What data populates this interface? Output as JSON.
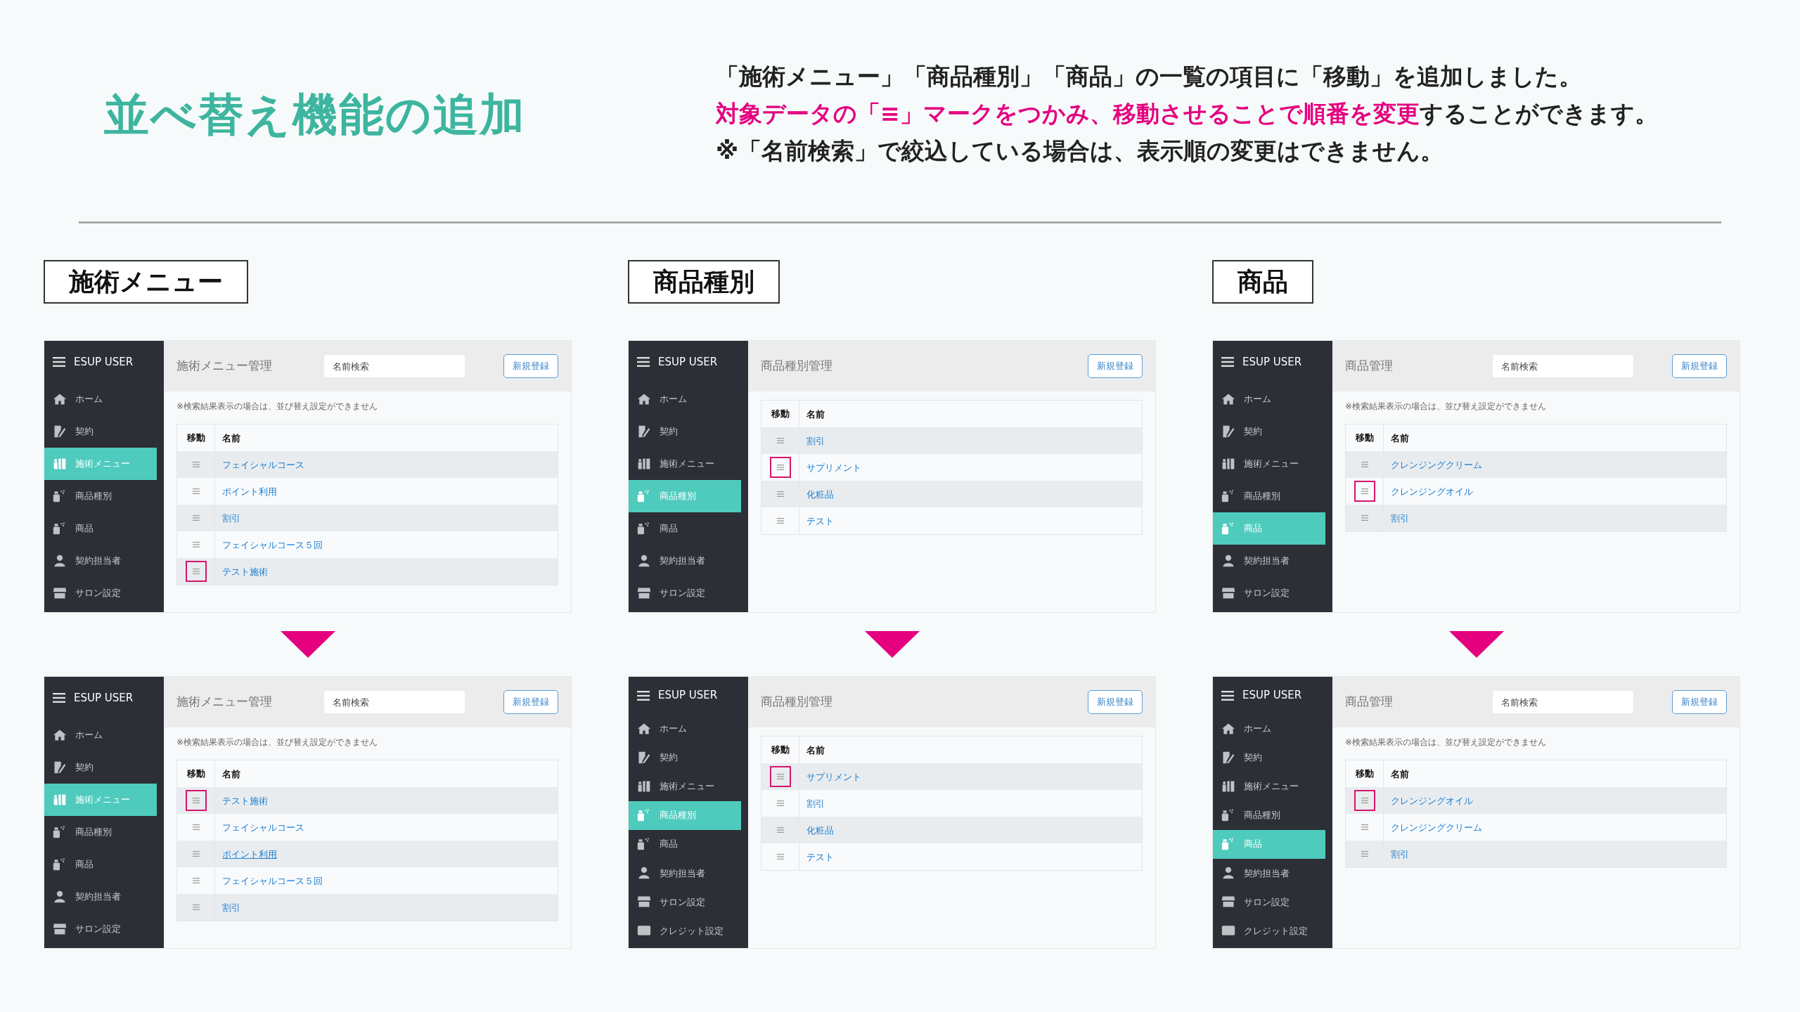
{
  "heading": "並べ替え機能の追加",
  "description": {
    "line_1": "「施術メニュー」「商品種別」「商品」の一覧の項目に「移動」を追加しました。",
    "line_2_highlight": "対象データの「≡」マークをつかみ、移動させることで順番を変更",
    "line_2_rest": "することができます。",
    "line_3": "※「名前検索」で絞込している場合は、表示順の変更はできません。"
  },
  "sections": [
    {
      "label": "施術メニュー",
      "before": {
        "brand": "ESUP USER",
        "sidebar": [
          {
            "label": "ホーム",
            "kind": "home",
            "selected": false
          },
          {
            "label": "契約",
            "kind": "contract",
            "selected": false
          },
          {
            "label": "施術メニュー",
            "kind": "treatment",
            "selected": true
          },
          {
            "label": "商品種別",
            "kind": "bottle",
            "selected": false
          },
          {
            "label": "商品",
            "kind": "bottle",
            "selected": false
          },
          {
            "label": "契約担当者",
            "kind": "person",
            "selected": false
          },
          {
            "label": "サロン設定",
            "kind": "store",
            "selected": false
          }
        ],
        "page_title": "施術メニュー管理",
        "search": {
          "placeholder": "名前検索"
        },
        "new_button": "新規登録",
        "note": "※検索結果表示の場合は、並び替え設定ができません",
        "columns": [
          "移動",
          "名前"
        ],
        "rows": [
          {
            "name": "フェイシャルコース",
            "marked": false,
            "hover": false
          },
          {
            "name": "ポイント利用",
            "marked": false,
            "hover": false
          },
          {
            "name": "割引",
            "marked": false,
            "hover": false
          },
          {
            "name": "フェイシャルコース５回",
            "marked": false,
            "hover": false
          },
          {
            "name": "テスト施術",
            "marked": true,
            "hover": false
          }
        ]
      },
      "after": {
        "brand": "ESUP USER",
        "sidebar": [
          {
            "label": "ホーム",
            "kind": "home",
            "selected": false
          },
          {
            "label": "契約",
            "kind": "contract",
            "selected": false
          },
          {
            "label": "施術メニュー",
            "kind": "treatment",
            "selected": true
          },
          {
            "label": "商品種別",
            "kind": "bottle",
            "selected": false
          },
          {
            "label": "商品",
            "kind": "bottle",
            "selected": false
          },
          {
            "label": "契約担当者",
            "kind": "person",
            "selected": false
          },
          {
            "label": "サロン設定",
            "kind": "store",
            "selected": false
          }
        ],
        "page_title": "施術メニュー管理",
        "search": {
          "placeholder": "名前検索"
        },
        "new_button": "新規登録",
        "note": "※検索結果表示の場合は、並び替え設定ができません",
        "columns": [
          "移動",
          "名前"
        ],
        "rows": [
          {
            "name": "テスト施術",
            "marked": true,
            "hover": false
          },
          {
            "name": "フェイシャルコース",
            "marked": false,
            "hover": false
          },
          {
            "name": "ポイント利用",
            "marked": false,
            "hover": true
          },
          {
            "name": "フェイシャルコース５回",
            "marked": false,
            "hover": false
          },
          {
            "name": "割引",
            "marked": false,
            "hover": false
          }
        ]
      }
    },
    {
      "label": "商品種別",
      "before": {
        "brand": "ESUP USER",
        "sidebar": [
          {
            "label": "ホーム",
            "kind": "home",
            "selected": false
          },
          {
            "label": "契約",
            "kind": "contract",
            "selected": false
          },
          {
            "label": "施術メニュー",
            "kind": "treatment",
            "selected": false
          },
          {
            "label": "商品種別",
            "kind": "bottle",
            "selected": true
          },
          {
            "label": "商品",
            "kind": "bottle",
            "selected": false
          },
          {
            "label": "契約担当者",
            "kind": "person",
            "selected": false
          },
          {
            "label": "サロン設定",
            "kind": "store",
            "selected": false
          }
        ],
        "page_title": "商品種別管理",
        "new_button": "新規登録",
        "columns": [
          "移動",
          "名前"
        ],
        "rows": [
          {
            "name": "割引",
            "marked": false,
            "hover": false
          },
          {
            "name": "サプリメント",
            "marked": true,
            "hover": false
          },
          {
            "name": "化粧品",
            "marked": false,
            "hover": false
          },
          {
            "name": "テスト",
            "marked": false,
            "hover": false
          }
        ]
      },
      "after": {
        "brand": "ESUP USER",
        "sidebar": [
          {
            "label": "ホーム",
            "kind": "home",
            "selected": false
          },
          {
            "label": "契約",
            "kind": "contract",
            "selected": false
          },
          {
            "label": "施術メニュー",
            "kind": "treatment",
            "selected": false
          },
          {
            "label": "商品種別",
            "kind": "bottle",
            "selected": true
          },
          {
            "label": "商品",
            "kind": "bottle",
            "selected": false
          },
          {
            "label": "契約担当者",
            "kind": "person",
            "selected": false
          },
          {
            "label": "サロン設定",
            "kind": "store",
            "selected": false
          },
          {
            "label": "クレジット設定",
            "kind": "card",
            "selected": false
          }
        ],
        "page_title": "商品種別管理",
        "new_button": "新規登録",
        "columns": [
          "移動",
          "名前"
        ],
        "rows": [
          {
            "name": "サプリメント",
            "marked": true,
            "hover": false
          },
          {
            "name": "割引",
            "marked": false,
            "hover": false
          },
          {
            "name": "化粧品",
            "marked": false,
            "hover": false
          },
          {
            "name": "テスト",
            "marked": false,
            "hover": false
          }
        ]
      }
    },
    {
      "label": "商品",
      "before": {
        "brand": "ESUP USER",
        "sidebar": [
          {
            "label": "ホーム",
            "kind": "home",
            "selected": false
          },
          {
            "label": "契約",
            "kind": "contract",
            "selected": false
          },
          {
            "label": "施術メニュー",
            "kind": "treatment",
            "selected": false
          },
          {
            "label": "商品種別",
            "kind": "bottle",
            "selected": false
          },
          {
            "label": "商品",
            "kind": "bottle",
            "selected": true
          },
          {
            "label": "契約担当者",
            "kind": "person",
            "selected": false
          },
          {
            "label": "サロン設定",
            "kind": "store",
            "selected": false
          }
        ],
        "page_title": "商品管理",
        "search": {
          "placeholder": "名前検索"
        },
        "new_button": "新規登録",
        "note": "※検索結果表示の場合は、並び替え設定ができません",
        "columns": [
          "移動",
          "名前"
        ],
        "rows": [
          {
            "name": "クレンジングクリーム",
            "marked": false,
            "hover": false
          },
          {
            "name": "クレンジングオイル",
            "marked": true,
            "hover": false
          },
          {
            "name": "割引",
            "marked": false,
            "hover": false
          }
        ]
      },
      "after": {
        "brand": "ESUP USER",
        "sidebar": [
          {
            "label": "ホーム",
            "kind": "home",
            "selected": false
          },
          {
            "label": "契約",
            "kind": "contract",
            "selected": false
          },
          {
            "label": "施術メニュー",
            "kind": "treatment",
            "selected": false
          },
          {
            "label": "商品種別",
            "kind": "bottle",
            "selected": false
          },
          {
            "label": "商品",
            "kind": "bottle",
            "selected": true
          },
          {
            "label": "契約担当者",
            "kind": "person",
            "selected": false
          },
          {
            "label": "サロン設定",
            "kind": "store",
            "selected": false
          },
          {
            "label": "クレジット設定",
            "kind": "card",
            "selected": false
          }
        ],
        "page_title": "商品管理",
        "search": {
          "placeholder": "名前検索"
        },
        "new_button": "新規登録",
        "note": "※検索結果表示の場合は、並び替え設定ができません",
        "columns": [
          "移動",
          "名前"
        ],
        "rows": [
          {
            "name": "クレンジングオイル",
            "marked": true,
            "hover": false
          },
          {
            "name": "クレンジングクリーム",
            "marked": false,
            "hover": false
          },
          {
            "name": "割引",
            "marked": false,
            "hover": false
          }
        ]
      }
    }
  ]
}
